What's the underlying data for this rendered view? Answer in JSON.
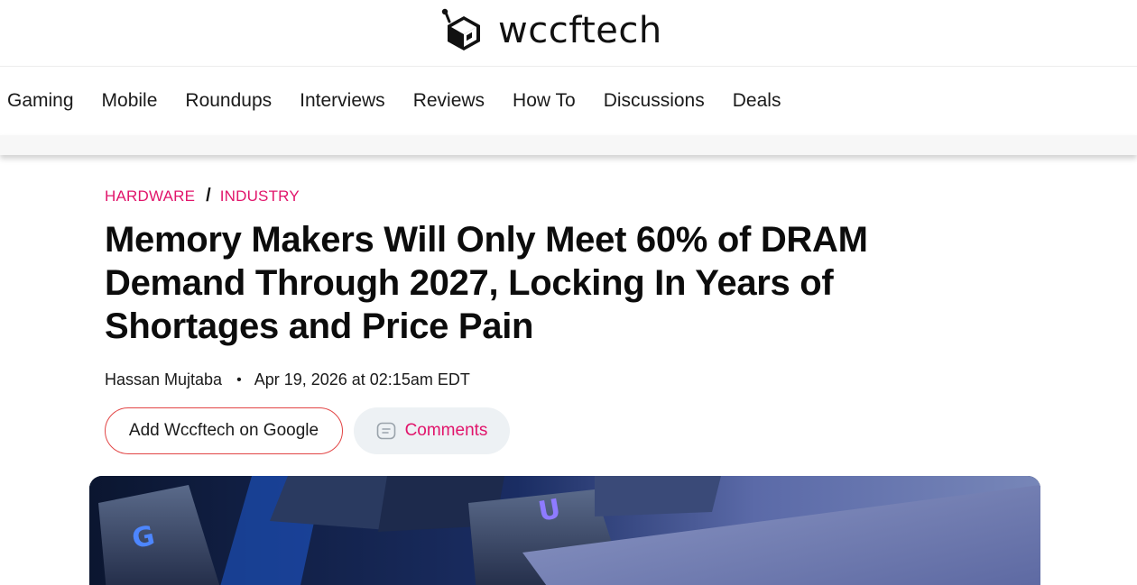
{
  "site": {
    "name": "wccftech",
    "logo_icon": "wccftech-robot-logo-icon"
  },
  "nav": {
    "items": [
      {
        "label": "Gaming"
      },
      {
        "label": "Mobile"
      },
      {
        "label": "Roundups"
      },
      {
        "label": "Interviews"
      },
      {
        "label": "Reviews"
      },
      {
        "label": "How To"
      },
      {
        "label": "Discussions"
      },
      {
        "label": "Deals"
      }
    ]
  },
  "article": {
    "breadcrumb": {
      "category": "HARDWARE",
      "separator": "/",
      "subcategory": "INDUSTRY"
    },
    "title": "Memory Makers Will Only Meet 60% of DRAM Demand Through 2027, Locking In Years of Shortages and Price Pain",
    "author": "Hassan Mujtaba",
    "separator_dot": "•",
    "date": "Apr 19, 2026 at 02:15am EDT",
    "add_google_label": "Add Wccftech on Google",
    "comments_label": "Comments",
    "comments_icon": "comment-bubble-icon",
    "hero_image": {
      "keycap_labels": [
        "G",
        "U"
      ]
    }
  },
  "colors": {
    "accent": "#e1156b",
    "google_button_border": "#e24545",
    "comments_button_bg": "#edf1f4"
  }
}
